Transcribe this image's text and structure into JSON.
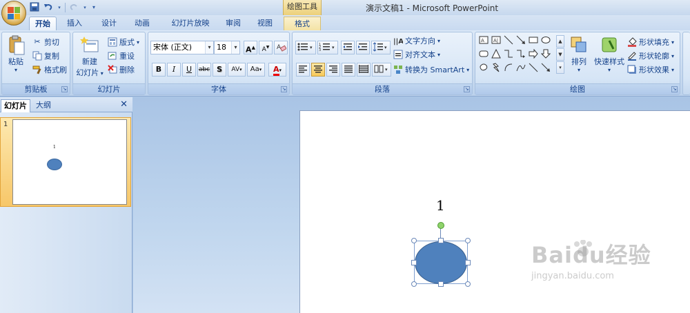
{
  "window": {
    "title": "演示文稿1 - Microsoft PowerPoint",
    "context_group": "绘图工具"
  },
  "tabs": [
    {
      "label": "开始",
      "active": true
    },
    {
      "label": "插入"
    },
    {
      "label": "设计"
    },
    {
      "label": "动画"
    },
    {
      "label": "幻灯片放映"
    },
    {
      "label": "审阅"
    },
    {
      "label": "视图"
    },
    {
      "label": "格式",
      "context": true
    }
  ],
  "ribbon": {
    "clipboard": {
      "label": "剪贴板",
      "paste": "粘贴",
      "cut": "剪切",
      "copy": "复制",
      "format_painter": "格式刷"
    },
    "slides": {
      "label": "幻灯片",
      "new_slide_line1": "新建",
      "new_slide_line2": "幻灯片",
      "layout": "版式",
      "reset": "重设",
      "delete": "删除"
    },
    "font": {
      "label": "字体",
      "font_name": "宋体 (正文)",
      "font_size": "18",
      "grow": "A",
      "shrink": "A",
      "bold": "B",
      "italic": "I",
      "underline": "U",
      "strike": "abc",
      "shadow": "S",
      "spacing": "AV",
      "case": "Aa",
      "color": "A"
    },
    "paragraph": {
      "label": "段落",
      "text_direction": "文字方向",
      "align_text": "对齐文本",
      "smartart": "转换为 SmartArt"
    },
    "drawing": {
      "label": "绘图",
      "arrange": "排列",
      "quick_styles": "快速样式",
      "shape_fill": "形状填充",
      "shape_outline": "形状轮廓",
      "shape_effects": "形状效果"
    }
  },
  "pane": {
    "tab_slides": "幻灯片",
    "tab_outline": "大纲",
    "slide_number": "1"
  },
  "slide": {
    "text": "1",
    "shape_color": "#4f81bd"
  },
  "watermark": {
    "main": "Baidu经验",
    "sub": "jingyan.baidu.com"
  }
}
